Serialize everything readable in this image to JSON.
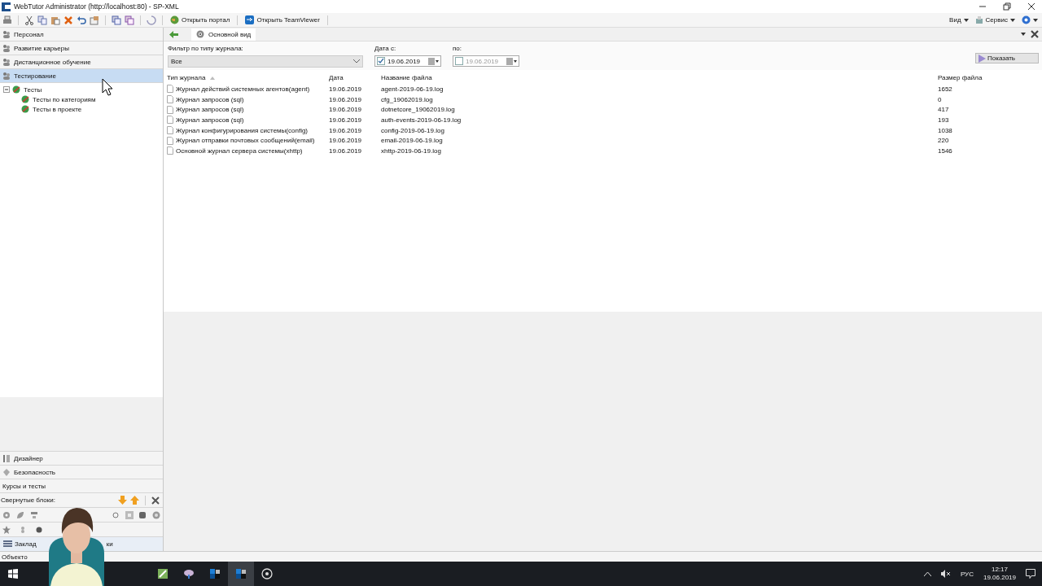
{
  "window": {
    "title": "WebTutor Administrator (http://localhost:80) - SP-XML"
  },
  "toolbar": {
    "buttons": [
      "Открыть портал",
      "Открыть TeamViewer"
    ],
    "menus": [
      "Вид",
      "Сервис"
    ]
  },
  "sidebar": {
    "sections": [
      {
        "label": "Персонал",
        "selected": false
      },
      {
        "label": "Развитие карьеры",
        "selected": false
      },
      {
        "label": "Дистанционное обучение",
        "selected": false
      },
      {
        "label": "Тестирование",
        "selected": true
      }
    ],
    "tree": [
      {
        "label": "Тесты",
        "expanded": true,
        "children": [
          {
            "label": "Тесты по категориям"
          },
          {
            "label": "Тесты в проекте"
          }
        ]
      }
    ],
    "bottom_sections": [
      "Дизайнер",
      "Безопасность",
      "Курсы и тесты"
    ],
    "collapsed_blocks": "Свернутые блоки:",
    "bottom_tab": [
      "Заклад",
      "ки"
    ]
  },
  "tabs": [
    {
      "label": "Основной вид",
      "selected": true
    }
  ],
  "filter": {
    "label": "Фильтр по типу журнала:",
    "value": "Все",
    "date_from": {
      "label": "Дата с:",
      "checked": true,
      "value": "19.06.2019"
    },
    "date_to": {
      "label": "по:",
      "checked": false,
      "value": "19.06.2019"
    },
    "button": "Показать"
  },
  "table": {
    "columns": [
      {
        "label": "Тип журнала",
        "sorted": true
      },
      {
        "label": "Дата",
        "sorted": false
      },
      {
        "label": "Название файла",
        "sorted": false
      },
      {
        "label": "Размер файла",
        "sorted": false
      }
    ],
    "rows": [
      [
        "Журнал действий системных агентов(agent)",
        "19.06.2019",
        "agent-2019-06-19.log",
        "1652"
      ],
      [
        "Журнал запросов (sql)",
        "19.06.2019",
        "cfg_19062019.log",
        "0"
      ],
      [
        "Журнал запросов (sql)",
        "19.06.2019",
        "dotnetcore_19062019.log",
        "417"
      ],
      [
        "Журнал запросов (sql)",
        "19.06.2019",
        "auth-events-2019-06-19.log",
        "193"
      ],
      [
        "Журнал конфигурирования системы(config)",
        "19.06.2019",
        "config-2019-06-19.log",
        "1038"
      ],
      [
        "Журнал отправки почтовых сообщений(email)",
        "19.06.2019",
        "email-2019-06-19.log",
        "220"
      ],
      [
        "Основной журнал сервера системы(xhttp)",
        "19.06.2019",
        "xhttp-2019-06-19.log",
        "1546"
      ]
    ]
  },
  "status_bar": "Объекто",
  "taskbar": {
    "apps": [
      {
        "selected": false
      },
      {
        "selected": false
      },
      {
        "selected": false
      },
      {
        "selected": true
      },
      {
        "selected": false
      }
    ],
    "language": "РУС",
    "time": "12:17",
    "date": "19.06.2019"
  }
}
